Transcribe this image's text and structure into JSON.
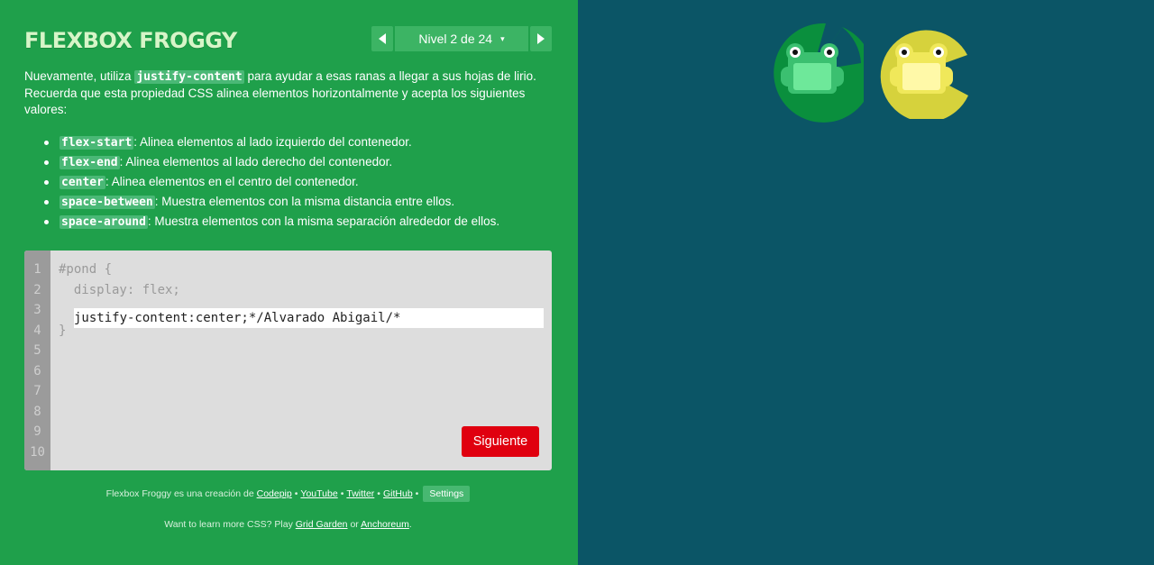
{
  "header": {
    "title": "FLEXBOX FROGGY",
    "prev_icon": "triangle-left-icon",
    "next_icon": "triangle-right-icon",
    "level_label": "Nivel 2 de 24",
    "level_caret": "▾"
  },
  "instructions": {
    "intro_1": "Nuevamente, utiliza ",
    "intro_code": "justify-content",
    "intro_2": " para ayudar a esas ranas a llegar a sus hojas de lirio. Recuerda que esta propiedad CSS alinea elementos horizontalmente y acepta los siguientes valores:",
    "values": [
      {
        "code": "flex-start",
        "desc": ": Alinea elementos al lado izquierdo del contenedor."
      },
      {
        "code": "flex-end",
        "desc": ": Alinea elementos al lado derecho del contenedor."
      },
      {
        "code": "center",
        "desc": ": Alinea elementos en el centro del contenedor."
      },
      {
        "code": "space-between",
        "desc": ": Muestra elementos con la misma distancia entre ellos."
      },
      {
        "code": "space-around",
        "desc": ": Muestra elementos con la misma separación alrededor de ellos."
      }
    ]
  },
  "editor": {
    "line_numbers": [
      "1",
      "2",
      "3",
      "4",
      "5",
      "6",
      "7",
      "8",
      "9",
      "10"
    ],
    "line_1": "#pond {",
    "line_2": "  display: flex;",
    "input_value": "justify-content:center;*/Alvarado Abigail/*",
    "line_4": "}",
    "next_button": "Siguiente"
  },
  "footer": {
    "credit_prefix": "Flexbox Froggy es una creación de ",
    "codepip": "Codepip",
    "youtube": "YouTube",
    "twitter": "Twitter",
    "github": "GitHub",
    "separator": "•",
    "settings": "Settings",
    "learn_prefix": "Want to learn more CSS? Play ",
    "grid_garden": "Grid Garden",
    "learn_or": " or ",
    "anchoreum": "Anchoreum",
    "learn_suffix": "."
  },
  "board": {
    "frogs": [
      {
        "color": "green",
        "pad_color": "#0a8f3d",
        "frog_color": "#43d17a"
      },
      {
        "color": "yellow",
        "pad_color": "#d6d23c",
        "frog_color": "#fff7a0"
      }
    ]
  }
}
